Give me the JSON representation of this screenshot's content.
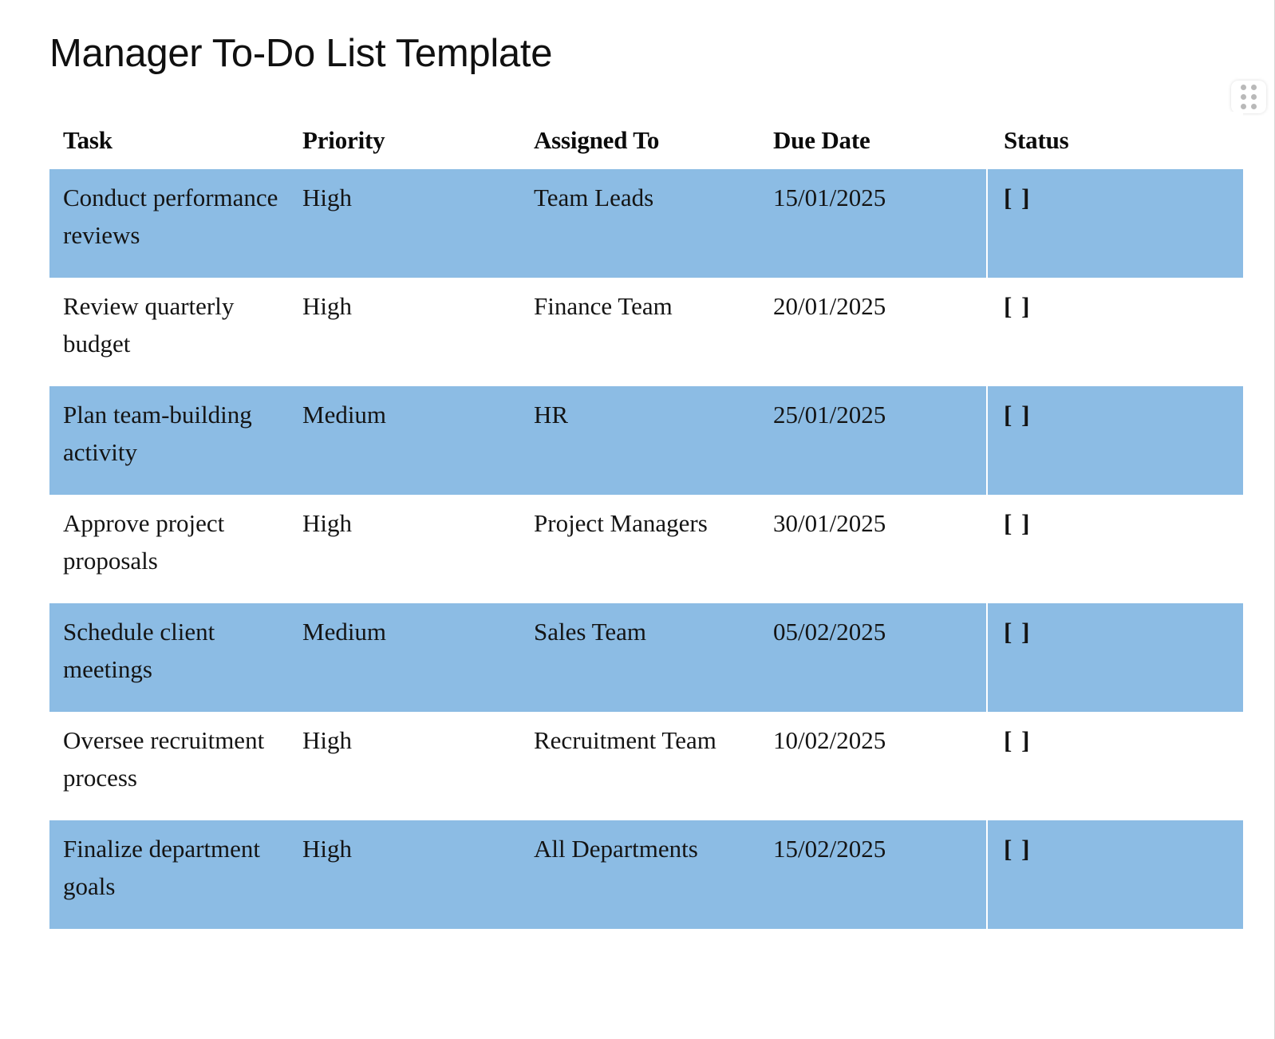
{
  "document": {
    "title": "Manager To-Do List Template"
  },
  "drag_handle": {
    "icon": "grip-dots-icon"
  },
  "table": {
    "columns": [
      "Task",
      "Priority",
      "Assigned To",
      "Due Date",
      "Status"
    ],
    "status_empty_mark": "[ ]",
    "shaded_row_color": "#8cbce4",
    "rows": [
      {
        "task": "Conduct performance reviews",
        "priority": "High",
        "assigned_to": "Team Leads",
        "due_date": "15/01/2025",
        "status": "[ ]",
        "shaded": true
      },
      {
        "task": "Review quarterly budget",
        "priority": "High",
        "assigned_to": "Finance Team",
        "due_date": "20/01/2025",
        "status": "[ ]",
        "shaded": false
      },
      {
        "task": "Plan team-building activity",
        "priority": "Medium",
        "assigned_to": "HR",
        "due_date": "25/01/2025",
        "status": "[ ]",
        "shaded": true
      },
      {
        "task": "Approve project proposals",
        "priority": "High",
        "assigned_to": "Project Managers",
        "due_date": "30/01/2025",
        "status": "[ ]",
        "shaded": false
      },
      {
        "task": "Schedule client meetings",
        "priority": "Medium",
        "assigned_to": "Sales Team",
        "due_date": "05/02/2025",
        "status": "[ ]",
        "shaded": true
      },
      {
        "task": "Oversee recruitment process",
        "priority": "High",
        "assigned_to": "Recruitment Team",
        "due_date": "10/02/2025",
        "status": "[ ]",
        "shaded": false
      },
      {
        "task": "Finalize department goals",
        "priority": "High",
        "assigned_to": "All Departments",
        "due_date": "15/02/2025",
        "status": "[ ]",
        "shaded": true
      }
    ]
  }
}
